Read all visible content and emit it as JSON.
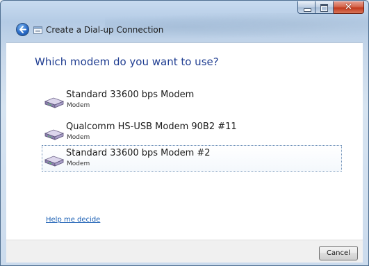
{
  "window": {
    "title": "Create a Dial-up Connection"
  },
  "content": {
    "heading": "Which modem do you want to use?",
    "modems": [
      {
        "name": "Standard 33600 bps Modem",
        "type": "Modem"
      },
      {
        "name": "Qualcomm HS-USB Modem 90B2 #11",
        "type": "Modem"
      },
      {
        "name": "Standard 33600 bps Modem #2",
        "type": "Modem"
      }
    ],
    "help_link": "Help me decide"
  },
  "footer": {
    "cancel_label": "Cancel"
  },
  "icons": {
    "back": "back-arrow-icon",
    "title": "dial-up-connection-icon",
    "modem": "modem-icon"
  },
  "colors": {
    "heading": "#1f3d91",
    "link": "#1a5fb4",
    "close_button": "#c2391d"
  }
}
